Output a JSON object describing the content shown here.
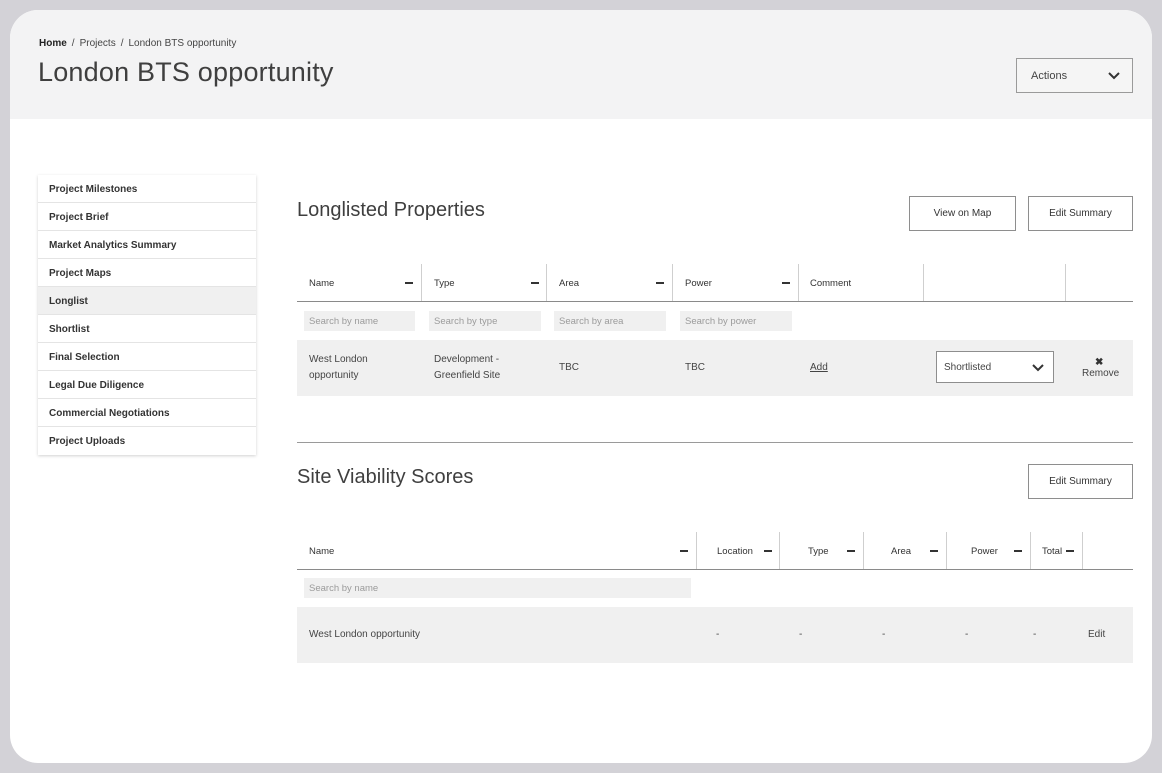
{
  "breadcrumb": {
    "home": "Home",
    "sep": "/",
    "projects": "Projects",
    "current": "London BTS opportunity"
  },
  "page": {
    "title": "London BTS opportunity",
    "actions_label": "Actions"
  },
  "sidebar": {
    "items": [
      {
        "label": "Project Milestones"
      },
      {
        "label": "Project Brief"
      },
      {
        "label": "Market Analytics Summary"
      },
      {
        "label": "Project Maps"
      },
      {
        "label": "Longlist",
        "active": true
      },
      {
        "label": "Shortlist"
      },
      {
        "label": "Final Selection"
      },
      {
        "label": "Legal Due Diligence"
      },
      {
        "label": "Commercial Negotiations"
      },
      {
        "label": "Project Uploads"
      }
    ]
  },
  "longlist": {
    "title": "Longlisted Properties",
    "view_map_label": "View on Map",
    "edit_summary_label": "Edit Summary",
    "columns": {
      "name": "Name",
      "type": "Type",
      "area": "Area",
      "power": "Power",
      "comment": "Comment"
    },
    "search": {
      "name": "Search by name",
      "type": "Search by type",
      "area": "Search by area",
      "power": "Search by power"
    },
    "row": {
      "name_line1": "West London",
      "name_line2": "opportunity",
      "type_line1": "Development -",
      "type_line2": "Greenfield Site",
      "area": "TBC",
      "power": "TBC",
      "comment": "Add",
      "status": "Shortlisted",
      "remove_icon": "✖",
      "remove_label": "Remove"
    }
  },
  "viability": {
    "title": "Site Viability Scores",
    "edit_summary_label": "Edit Summary",
    "columns": {
      "name": "Name",
      "location": "Location",
      "type": "Type",
      "area": "Area",
      "power": "Power",
      "total": "Total"
    },
    "search": {
      "name": "Search by name"
    },
    "row": {
      "name": "West London opportunity",
      "location": "-",
      "type": "-",
      "area": "-",
      "power": "-",
      "total": "-",
      "edit": "Edit"
    }
  }
}
